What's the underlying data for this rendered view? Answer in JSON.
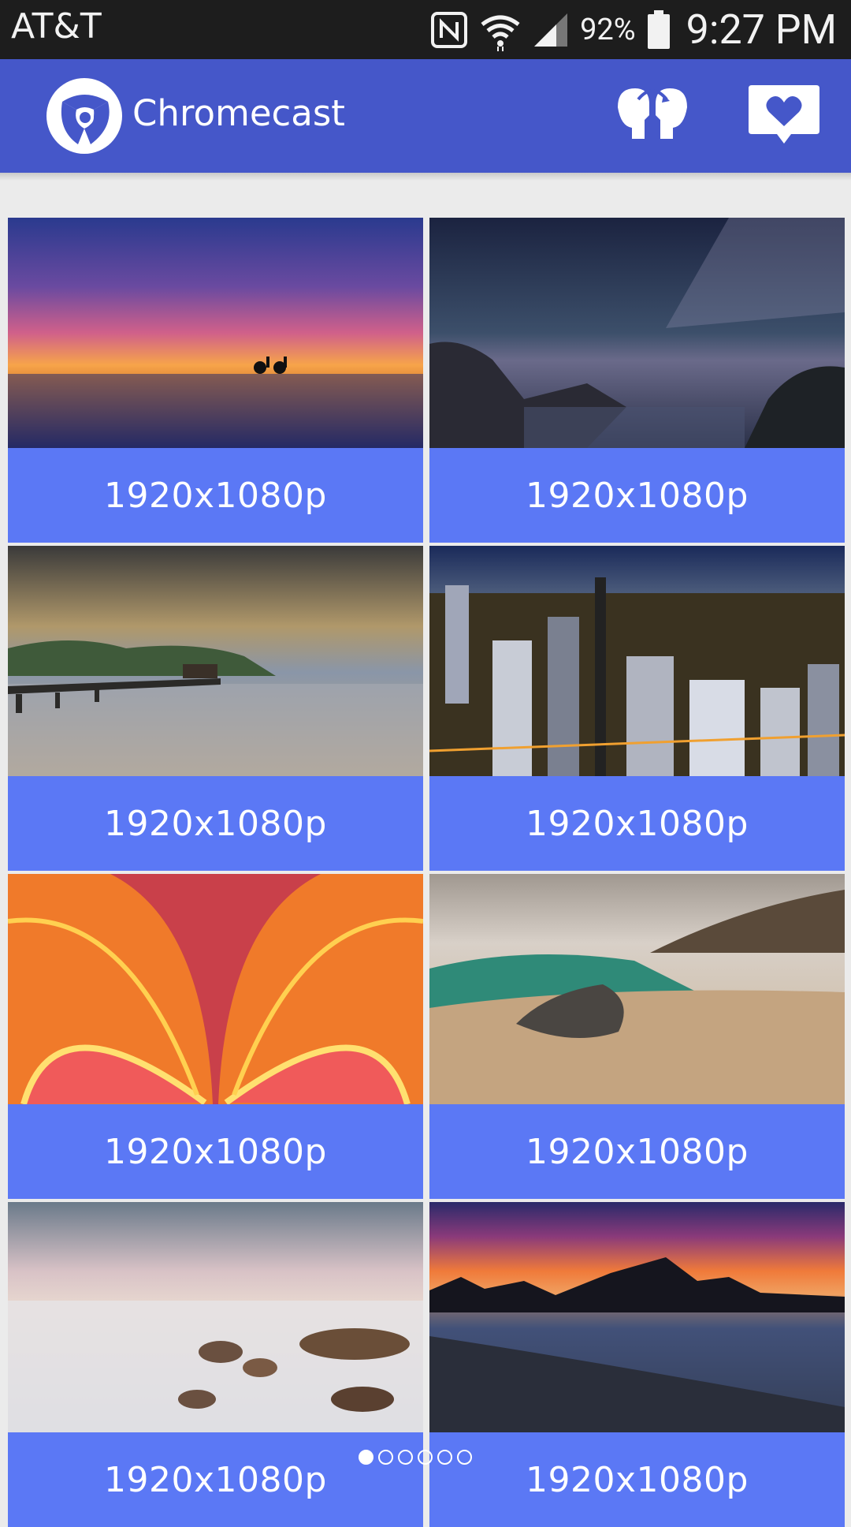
{
  "status": {
    "carrier": "AT&T",
    "battery_percent": "92%",
    "time": "9:27 PM",
    "icons": [
      "nfc-icon",
      "wifi-icon",
      "cell-signal-icon",
      "battery-icon"
    ]
  },
  "app_bar": {
    "title": "Chromecast",
    "logo_icon": "chromecast-logo-icon",
    "actions": [
      "face-swap-icon",
      "heart-message-icon"
    ],
    "color": "#4557c9"
  },
  "cards": [
    {
      "label": "1920x1080p",
      "scene": "sunset-beach-bicycles"
    },
    {
      "label": "1920x1080p",
      "scene": "milky-way-coastline"
    },
    {
      "label": "1920x1080p",
      "scene": "pier-cloudy-bay"
    },
    {
      "label": "1920x1080p",
      "scene": "city-night-skyline"
    },
    {
      "label": "1920x1080p",
      "scene": "abstract-orange-petals"
    },
    {
      "label": "1920x1080p",
      "scene": "wave-rocky-beach"
    },
    {
      "label": "1920x1080p",
      "scene": "misty-rocks-shore"
    },
    {
      "label": "1920x1080p",
      "scene": "sunset-rock-beach"
    }
  ],
  "card_color": "#5b78f5",
  "pager": {
    "total": 6,
    "active_index": 0
  }
}
